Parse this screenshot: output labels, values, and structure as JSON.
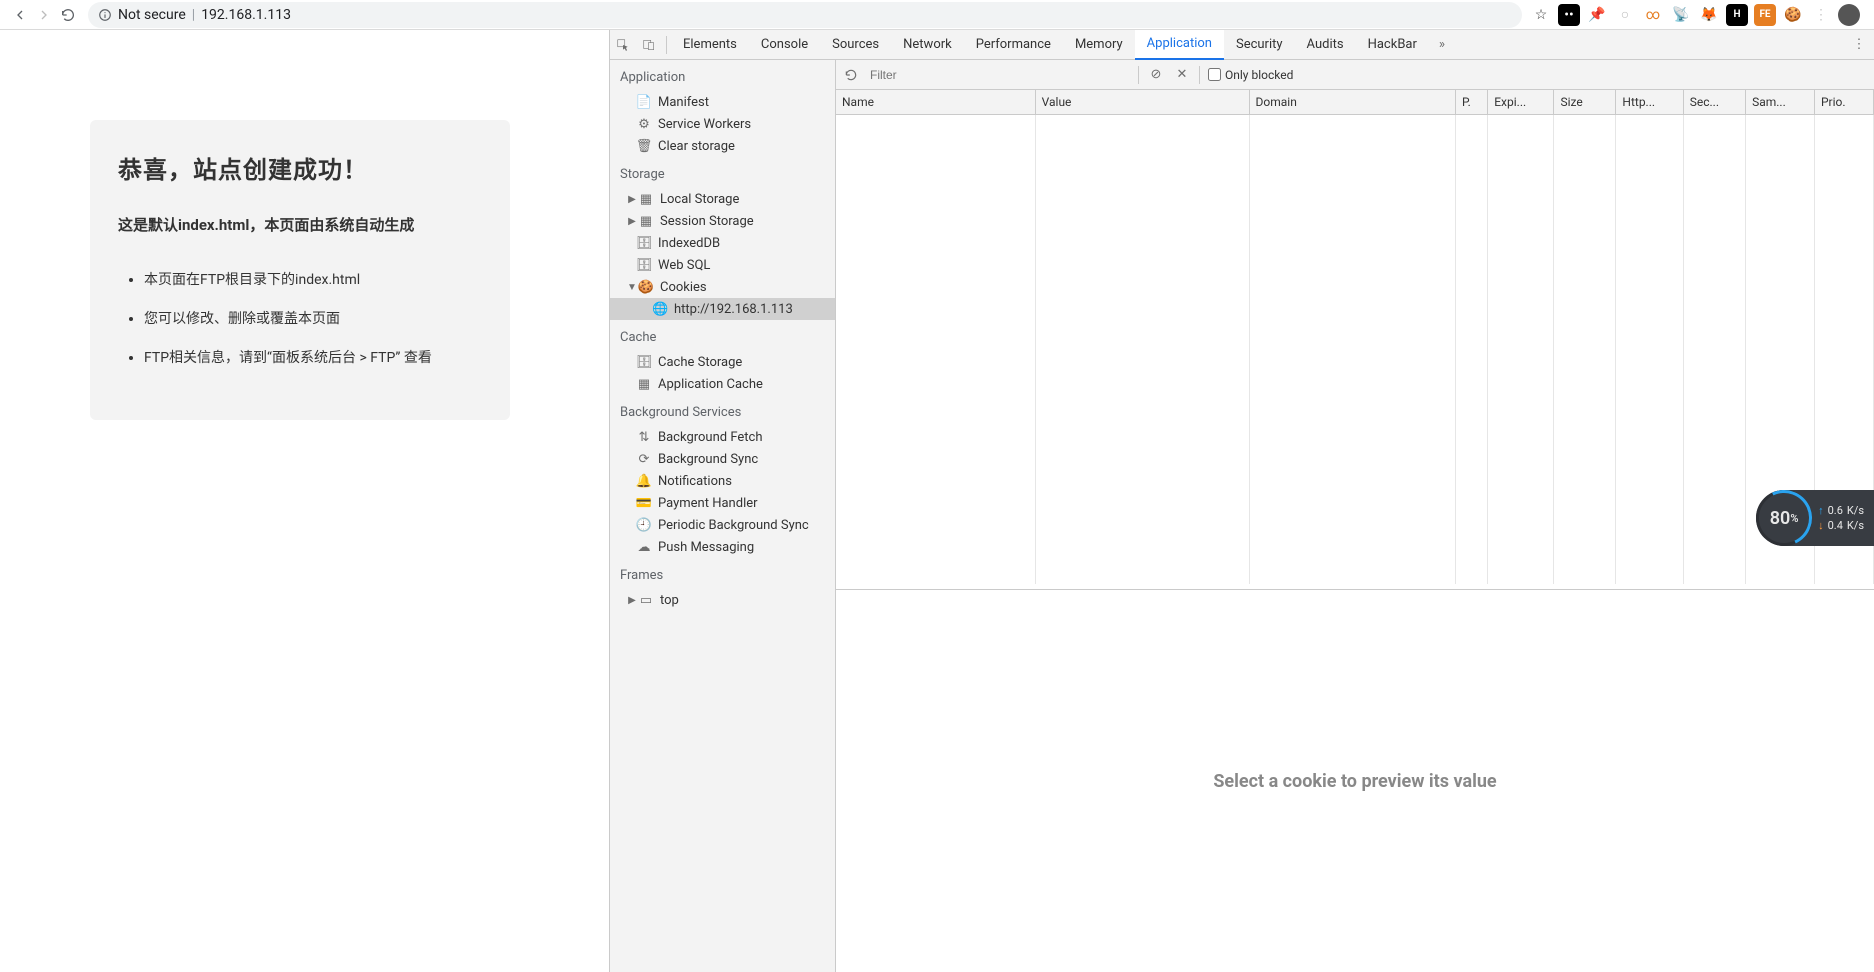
{
  "browser": {
    "security_label": "Not secure",
    "url": "192.168.1.113"
  },
  "page": {
    "title": "恭喜，站点创建成功！",
    "subtitle": "这是默认index.html，本页面由系统自动生成",
    "bullets": [
      "本页面在FTP根目录下的index.html",
      "您可以修改、删除或覆盖本页面",
      "FTP相关信息，请到“面板系统后台 > FTP” 查看"
    ]
  },
  "devtools": {
    "tabs": [
      "Elements",
      "Console",
      "Sources",
      "Network",
      "Performance",
      "Memory",
      "Application",
      "Security",
      "Audits",
      "HackBar"
    ],
    "active_tab": "Application",
    "sidebar": {
      "sections": {
        "application": {
          "title": "Application",
          "items": [
            "Manifest",
            "Service Workers",
            "Clear storage"
          ]
        },
        "storage": {
          "title": "Storage",
          "items": [
            "Local Storage",
            "Session Storage",
            "IndexedDB",
            "Web SQL",
            "Cookies"
          ],
          "cookies_children": [
            "http://192.168.1.113"
          ]
        },
        "cache": {
          "title": "Cache",
          "items": [
            "Cache Storage",
            "Application Cache"
          ]
        },
        "background": {
          "title": "Background Services",
          "items": [
            "Background Fetch",
            "Background Sync",
            "Notifications",
            "Payment Handler",
            "Periodic Background Sync",
            "Push Messaging"
          ]
        },
        "frames": {
          "title": "Frames",
          "items": [
            "top"
          ]
        }
      }
    },
    "filter_placeholder": "Filter",
    "only_blocked_label": "Only blocked",
    "table_headers": [
      "Name",
      "Value",
      "Domain",
      "P.",
      "Expi...",
      "Size",
      "Http...",
      "Sec...",
      "Sam...",
      "Prio."
    ],
    "preview_empty": "Select a cookie to preview its value"
  },
  "net_widget": {
    "percent": "80",
    "percent_suffix": "%",
    "upload": "0.6",
    "download": "0.4",
    "unit": "K/s"
  }
}
